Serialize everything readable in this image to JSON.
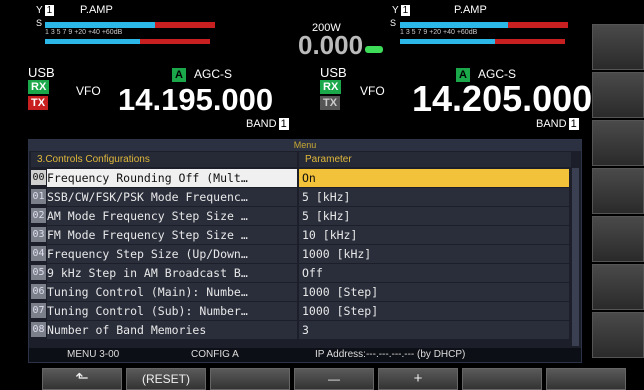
{
  "left_vfo": {
    "meter_label": "P.AMP",
    "scale_text": "1  3  5  7  9   +20  +40 +60dB",
    "mode": "USB",
    "rx": "RX",
    "tx": "TX",
    "a_badge": "A",
    "agc": "AGC-S",
    "vfo": "VFO",
    "freq": "14.195.000",
    "band": "BAND"
  },
  "center": {
    "power": "200W",
    "value": "0.000"
  },
  "right_vfo": {
    "meter_label": "P.AMP",
    "mode": "USB",
    "rx": "RX",
    "tx": "TX",
    "a_badge": "A",
    "agc": "AGC-S",
    "vfo": "VFO",
    "freq": "14.205.000",
    "band": "BAND"
  },
  "menu": {
    "title": "Menu",
    "section": "3.Controls Configurations",
    "param_header": "Parameter",
    "rows": [
      {
        "num": "00",
        "name": "Frequency Rounding Off (Mult…",
        "value": "On"
      },
      {
        "num": "01",
        "name": "SSB/CW/FSK/PSK Mode Frequenc…",
        "value": "5 [kHz]"
      },
      {
        "num": "02",
        "name": "AM Mode Frequency Step Size …",
        "value": "5 [kHz]"
      },
      {
        "num": "03",
        "name": "FM Mode Frequency Step Size …",
        "value": "10 [kHz]"
      },
      {
        "num": "04",
        "name": "Frequency Step Size (Up/Down…",
        "value": "1000 [kHz]"
      },
      {
        "num": "05",
        "name": "9 kHz Step in AM Broadcast B…",
        "value": "Off"
      },
      {
        "num": "06",
        "name": "Tuning Control (Main): Numbe…",
        "value": "1000 [Step]"
      },
      {
        "num": "07",
        "name": "Tuning Control (Sub): Number…",
        "value": "1000 [Step]"
      },
      {
        "num": "08",
        "name": "Number of Band Memories",
        "value": "3"
      }
    ],
    "status_menu": "MENU 3-00",
    "status_config": "CONFIG A",
    "status_ip": "IP Address:---.---.---.--- (by DHCP)"
  },
  "fkeys": {
    "f1": "⬑",
    "f2": "(RESET)",
    "f3": "",
    "f4": "—",
    "f5": "+",
    "f6": ""
  },
  "colors": {
    "accent_yellow": "#f2c23a",
    "rx_green": "#1aa84a",
    "tx_red": "#c82020",
    "meter_cyan": "#2bb8e8"
  }
}
